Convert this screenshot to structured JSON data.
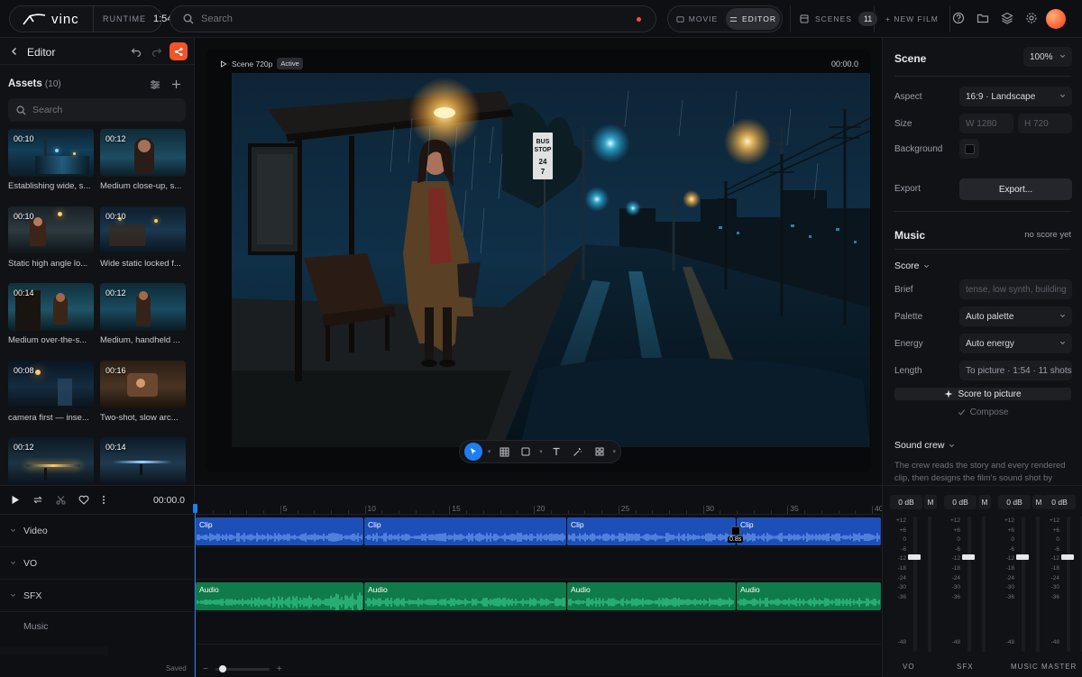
{
  "brand": {
    "logo_text": "vinc"
  },
  "topbar": {
    "runtime_label": "RUNTIME",
    "runtime_value": "1:54",
    "search_placeholder": "Search",
    "mode_movie": "MOVIE",
    "mode_editor": "EDITOR",
    "active_mode": "editor",
    "scenes_label": "SCENES",
    "scenes_count": "11",
    "new_film": "+ NEW FILM"
  },
  "editor": {
    "title": "Editor",
    "assets_label": "Assets",
    "assets_count": "(10)",
    "search_placeholder": "Search",
    "assets": [
      {
        "duration": "00:10",
        "caption": "Establishing wide, s..."
      },
      {
        "duration": "00:12",
        "caption": "Medium close-up, s..."
      },
      {
        "duration": "00:10",
        "caption": "Static high angle lo..."
      },
      {
        "duration": "00:10",
        "caption": "Wide static locked f..."
      },
      {
        "duration": "00:14",
        "caption": "Medium over-the-s..."
      },
      {
        "duration": "00:12",
        "caption": "Medium, handheld ..."
      },
      {
        "duration": "00:08",
        "caption": "camera first — inse..."
      },
      {
        "duration": "00:16",
        "caption": "Two-shot, slow arc..."
      },
      {
        "duration": "00:12",
        "caption": ""
      },
      {
        "duration": "00:14",
        "caption": ""
      }
    ]
  },
  "viewer": {
    "scene_label": "Scene 720p",
    "status_badge": "Active",
    "timecode": "00:00.0",
    "bus_stop_sign": [
      "BUS",
      "STOP",
      "24",
      "7"
    ]
  },
  "scene_panel": {
    "title": "Scene",
    "zoom": "100%",
    "aspect_label": "Aspect",
    "aspect_value": "16:9 · Landscape",
    "size_label": "Size",
    "width_placeholder": "W 1280",
    "height_placeholder": "H 720",
    "background_label": "Background",
    "background_color": "#0a0a0a",
    "export_label": "Export",
    "export_button": "Export...",
    "music_title": "Music",
    "music_status": "no score yet",
    "score_label": "Score",
    "brief_label": "Brief",
    "brief_placeholder": "tense, low synth, building",
    "palette_label": "Palette",
    "palette_value": "Auto palette",
    "energy_label": "Energy",
    "energy_value": "Auto energy",
    "length_label": "Length",
    "length_value": "To picture · 1:54 · 11 shots",
    "score_button": "Score to picture",
    "compose_button": "Compose",
    "sound_crew_label": "Sound crew",
    "sound_crew_text": "The crew reads the story and every rendered clip, then designs the film's sound shot by"
  },
  "timeline": {
    "timecode": "00:00.0",
    "ruler_labels": [
      "5",
      "10",
      "15",
      "20",
      "25",
      "30",
      "35",
      "40"
    ],
    "tracks": [
      "Video",
      "VO",
      "SFX",
      "Music"
    ],
    "video_clips": [
      "Clip",
      "Clip",
      "Clip",
      "Clip"
    ],
    "audio_clips": [
      "Audio",
      "Audio",
      "Audio",
      "Audio"
    ],
    "clip_tooltip": "0.8s",
    "saved_label": "Saved"
  },
  "mixer": {
    "channels": [
      {
        "name": "VO",
        "db": "0 dB",
        "mute": "M"
      },
      {
        "name": "SFX",
        "db": "0 dB",
        "mute": "M"
      },
      {
        "name": "MUSIC",
        "db": "0 dB",
        "mute": "M"
      },
      {
        "name": "MASTER",
        "db": "0 dB",
        "mute": ""
      }
    ],
    "scale": [
      "+12",
      "+6",
      "0",
      "-6",
      "-12",
      "-18",
      "-24",
      "-30",
      "-36",
      "-48"
    ]
  },
  "colors": {
    "accent": "#1f7df2",
    "share": "#f0552a",
    "video_clip": "#1d4fb8",
    "audio_clip": "#0f7a4a",
    "record_dot": "#ff4d3d"
  }
}
